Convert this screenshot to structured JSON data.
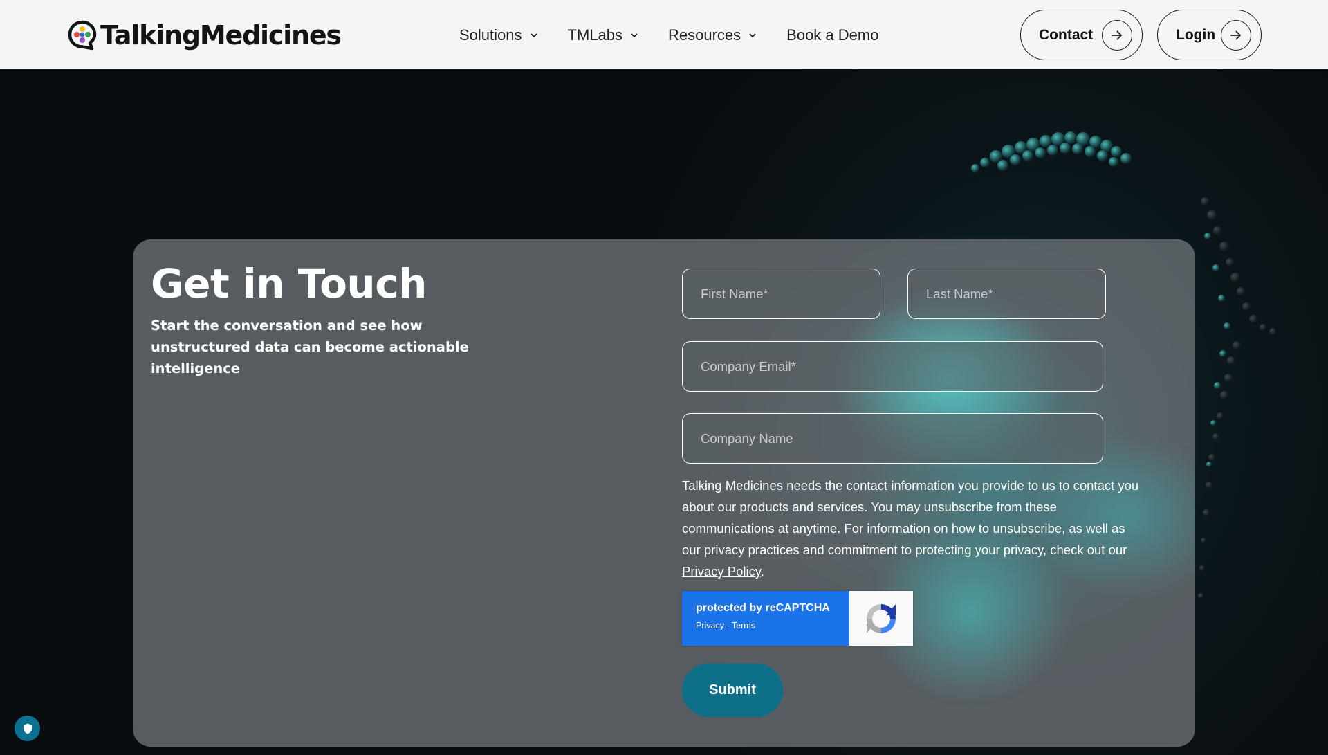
{
  "header": {
    "logo_text": "TalkingMedicines",
    "nav": [
      {
        "label": "Solutions",
        "has_dropdown": true
      },
      {
        "label": "TMLabs",
        "has_dropdown": true
      },
      {
        "label": "Resources",
        "has_dropdown": true
      },
      {
        "label": "Book a Demo",
        "has_dropdown": false
      }
    ],
    "contact_label": "Contact",
    "login_label": "Login"
  },
  "form_card": {
    "title": "Get in Touch",
    "subtitle": "Start the conversation and see how unstructured data can become actionable intelligence",
    "fields": {
      "first_name": {
        "placeholder": "First Name*",
        "value": ""
      },
      "last_name": {
        "placeholder": "Last Name*",
        "value": ""
      },
      "company_email": {
        "placeholder": "Company Email*",
        "value": ""
      },
      "company_name": {
        "placeholder": "Company Name",
        "value": ""
      }
    },
    "consent_text": "Talking Medicines needs the contact information you provide to us to contact you about our products and services. You may unsubscribe from these communications at anytime. For information on how to unsubscribe, as well as our privacy practices and commitment to protecting your privacy, check out our ",
    "privacy_link": "Privacy Policy",
    "consent_end": ".",
    "recaptcha": {
      "title": "protected by reCAPTCHA",
      "privacy": "Privacy",
      "separator": " - ",
      "terms": "Terms"
    },
    "submit_label": "Submit"
  },
  "icons": {
    "logo": "speech-bubble-pills-icon",
    "dropdown": "chevron-down-icon",
    "arrow": "arrow-right-circle-icon",
    "recaptcha": "recaptcha-logo-icon",
    "privacy_badge": "shield-icon"
  },
  "colors": {
    "header_bg": "#f4f5f5",
    "page_bg": "#0b1012",
    "card_bg": "rgba(118,124,127,0.72)",
    "submit_bg": "#0e6f88",
    "recaptcha_blue": "#1a73e8",
    "accent_teal": "#54dedc",
    "badge_bg": "#0c7191"
  }
}
